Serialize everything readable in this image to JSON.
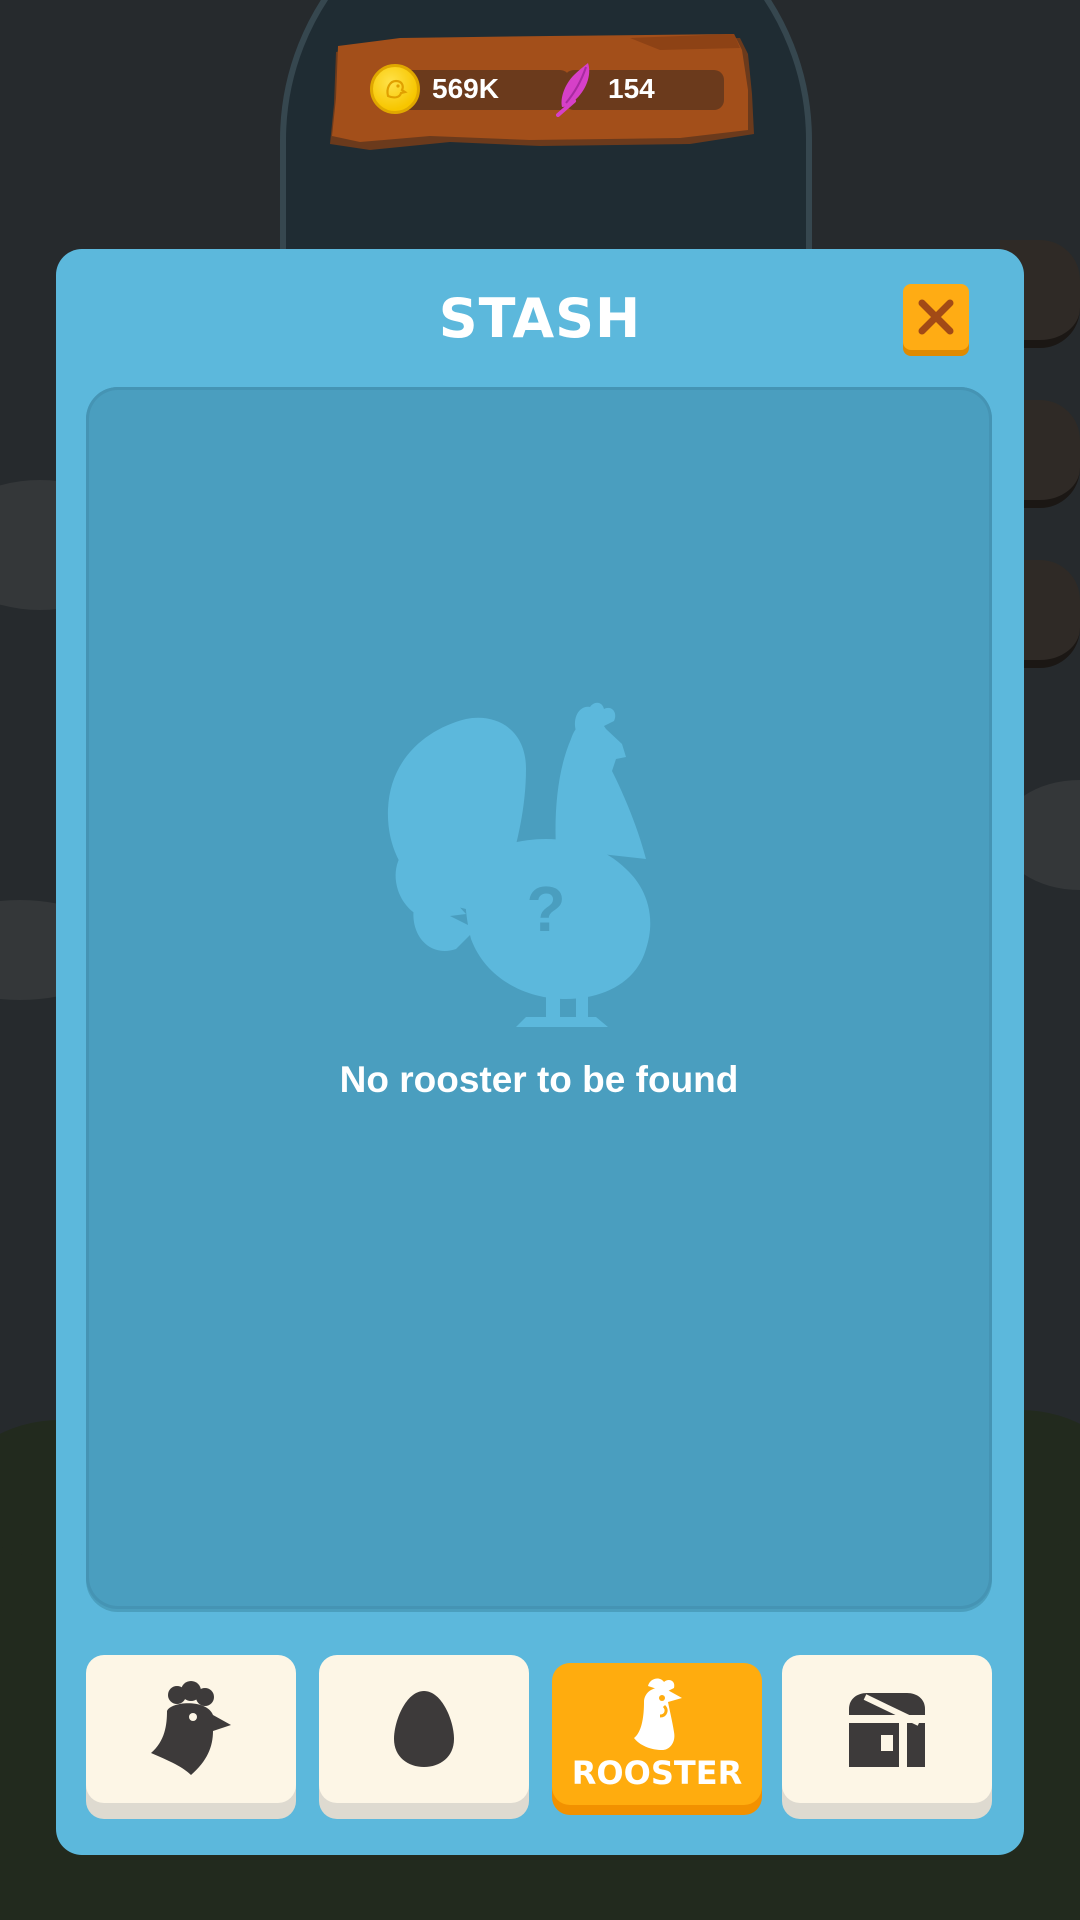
{
  "currency": {
    "coins": "569K",
    "feathers": "154",
    "coin_icon": "coin-icon",
    "feather_icon": "feather-icon"
  },
  "modal": {
    "title": "STASH",
    "close_icon": "close-icon",
    "empty_message": "No rooster to be found",
    "placeholder_icon": "rooster-silhouette-icon",
    "placeholder_mark": "?"
  },
  "tabs": [
    {
      "id": "hen",
      "icon": "hen-icon",
      "label": "",
      "active": false
    },
    {
      "id": "egg",
      "icon": "egg-icon",
      "label": "",
      "active": false
    },
    {
      "id": "rooster",
      "icon": "rooster-icon",
      "label": "ROOSTER",
      "active": true
    },
    {
      "id": "chest",
      "icon": "chest-icon",
      "label": "",
      "active": false
    }
  ],
  "colors": {
    "modal_bg": "#5cb8dc",
    "panel_bg": "#4a9ebf",
    "accent": "#ffac14",
    "tab_bg": "#fdf6e6",
    "sign_wood": "#a34f1a"
  }
}
